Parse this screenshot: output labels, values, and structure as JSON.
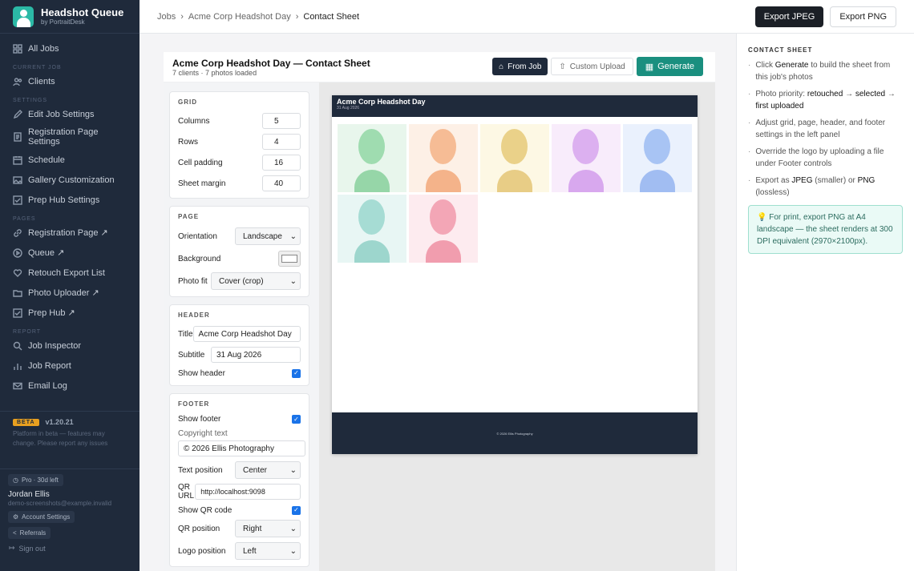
{
  "brand": {
    "title": "Headshot Queue",
    "subtitle": "by PortraitDesk"
  },
  "sidebar": {
    "top": [
      {
        "label": "All Jobs",
        "icon": "grid-icon"
      }
    ],
    "sections": [
      {
        "title": "CURRENT JOB",
        "items": [
          {
            "label": "Clients",
            "icon": "users-icon"
          }
        ]
      },
      {
        "title": "SETTINGS",
        "items": [
          {
            "label": "Edit Job Settings",
            "icon": "pencil-icon"
          },
          {
            "label": "Registration Page Settings",
            "icon": "document-icon"
          },
          {
            "label": "Schedule",
            "icon": "calendar-icon"
          },
          {
            "label": "Gallery Customization",
            "icon": "image-icon"
          },
          {
            "label": "Prep Hub Settings",
            "icon": "checkbox-icon"
          }
        ]
      },
      {
        "title": "PAGES",
        "items": [
          {
            "label": "Registration Page ↗",
            "icon": "link-icon"
          },
          {
            "label": "Queue ↗",
            "icon": "play-icon"
          },
          {
            "label": "Retouch Export List",
            "icon": "heart-icon"
          },
          {
            "label": "Photo Uploader ↗",
            "icon": "folder-icon"
          },
          {
            "label": "Prep Hub ↗",
            "icon": "checkbox-icon"
          }
        ]
      },
      {
        "title": "REPORT",
        "items": [
          {
            "label": "Job Inspector",
            "icon": "search-icon"
          },
          {
            "label": "Job Report",
            "icon": "bar-chart-icon"
          },
          {
            "label": "Email Log",
            "icon": "mail-icon"
          }
        ]
      }
    ],
    "beta": "BETA",
    "version": "v1.20.21",
    "beta_note": "Platform in beta — features may change. Please report any issues",
    "plan": "Pro · 30d left",
    "user_name": "Jordan Ellis",
    "user_email": "demo-screenshots@example.invalid",
    "account": "Account Settings",
    "referrals": "Referrals",
    "signout": "Sign out"
  },
  "breadcrumb": [
    "Jobs",
    "Acme Corp Headshot Day",
    "Contact Sheet"
  ],
  "toolbar": {
    "export_jpeg": "Export JPEG",
    "export_png": "Export PNG"
  },
  "card": {
    "title": "Acme Corp Headshot Day — Contact Sheet",
    "subtitle": "7 clients · 7 photos loaded",
    "from_job": "From Job",
    "custom_upload": "Custom Upload",
    "generate": "Generate"
  },
  "grid_panel": {
    "title": "GRID",
    "columns_label": "Columns",
    "columns": "5",
    "rows_label": "Rows",
    "rows": "4",
    "padding_label": "Cell padding",
    "padding": "16",
    "margin_label": "Sheet margin",
    "margin": "40"
  },
  "page_panel": {
    "title": "PAGE",
    "orientation_label": "Orientation",
    "orientation": "Landscape",
    "background_label": "Background",
    "fit_label": "Photo fit",
    "fit": "Cover (crop)"
  },
  "header_panel": {
    "title": "HEADER",
    "title_label": "Title",
    "title_value": "Acme Corp Headshot Day",
    "subtitle_label": "Subtitle",
    "subtitle_value": "31 Aug 2026",
    "show_label": "Show header"
  },
  "footer_panel": {
    "title": "FOOTER",
    "show_label": "Show footer",
    "copyright_label": "Copyright text",
    "copyright": "© 2026 Ellis Photography",
    "textpos_label": "Text position",
    "textpos": "Center",
    "qr_label": "QR URL",
    "qr_url": "http://localhost:9098",
    "showqr_label": "Show QR code",
    "qrpos_label": "QR position",
    "qrpos": "Right",
    "logopos_label": "Logo position",
    "logopos": "Left"
  },
  "sheet": {
    "title": "Acme Corp Headshot Day",
    "subtitle": "31 Aug 2026",
    "footer": "© 2026 Ellis Photography",
    "cells": [
      {
        "bg": "#e8f6ec",
        "head": "#9fdcb0",
        "body": "#96d6a8"
      },
      {
        "bg": "#fdf0e6",
        "head": "#f6bc95",
        "body": "#f4b38a"
      },
      {
        "bg": "#fdf8e4",
        "head": "#ead189",
        "body": "#e8cd86"
      },
      {
        "bg": "#f8ecfb",
        "head": "#dcb0f0",
        "body": "#d8a8ee"
      },
      {
        "bg": "#eaf1fd",
        "head": "#a8c4f4",
        "body": "#a1bdf2"
      },
      {
        "bg": "#e8f6f4",
        "head": "#a6dcd4",
        "body": "#9dd6cd"
      },
      {
        "bg": "#fdebef",
        "head": "#f3a6b6",
        "body": "#f19dae"
      }
    ]
  },
  "help": {
    "title": "CONTACT SHEET",
    "tips": [
      [
        "Click ",
        {
          "b": "Generate"
        },
        " to build the sheet from this job's photos"
      ],
      [
        "Photo priority: ",
        {
          "b": "retouched"
        },
        " → ",
        {
          "b": "selected"
        },
        " → ",
        {
          "b": "first uploaded"
        }
      ],
      [
        "Adjust grid, page, header, and footer settings in the left panel"
      ],
      [
        "Override the logo by uploading a file under Footer controls"
      ],
      [
        "Export as ",
        {
          "b": "JPEG"
        },
        " (smaller) or ",
        {
          "b": "PNG"
        },
        " (lossless)"
      ]
    ],
    "hint": "💡 For print, export PNG at A4 landscape — the sheet renders at 300 DPI equivalent (2970×2100px)."
  }
}
